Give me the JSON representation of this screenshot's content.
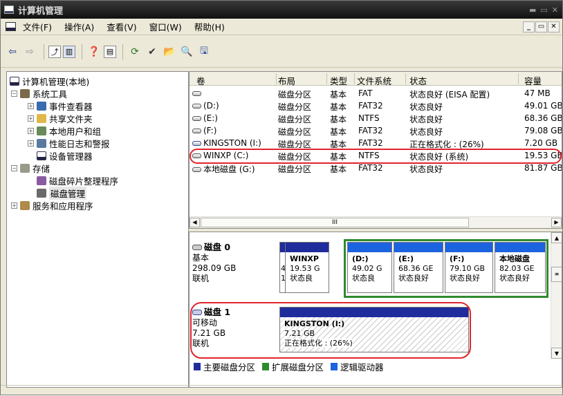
{
  "window": {
    "title": "计算机管理"
  },
  "menu": [
    "文件(F)",
    "操作(A)",
    "查看(V)",
    "窗口(W)",
    "帮助(H)"
  ],
  "tree": {
    "root": "计算机管理(本地)",
    "system_tools": "系统工具",
    "event_viewer": "事件查看器",
    "shared_folders": "共享文件夹",
    "local_users": "本地用户和组",
    "perf_logs": "性能日志和警报",
    "device_manager": "设备管理器",
    "storage": "存储",
    "defrag": "磁盘碎片整理程序",
    "disk_mgmt": "磁盘管理",
    "services": "服务和应用程序"
  },
  "volume_list": {
    "headers": [
      "卷",
      "布局",
      "类型",
      "文件系统",
      "状态",
      "容量"
    ],
    "rows": [
      {
        "vol": "",
        "layout": "磁盘分区",
        "type": "基本",
        "fs": "FAT",
        "status": "状态良好 (EISA 配置)",
        "cap": "47 MB"
      },
      {
        "vol": "(D:)",
        "layout": "磁盘分区",
        "type": "基本",
        "fs": "FAT32",
        "status": "状态良好",
        "cap": "49.01 GB"
      },
      {
        "vol": "(E:)",
        "layout": "磁盘分区",
        "type": "基本",
        "fs": "NTFS",
        "status": "状态良好",
        "cap": "68.36 GB"
      },
      {
        "vol": "(F:)",
        "layout": "磁盘分区",
        "type": "基本",
        "fs": "FAT32",
        "status": "状态良好",
        "cap": "79.08 GB"
      },
      {
        "vol": "KINGSTON (I:)",
        "layout": "磁盘分区",
        "type": "基本",
        "fs": "FAT32",
        "status": "正在格式化 : (26%)",
        "cap": "7.20 GB"
      },
      {
        "vol": "WINXP (C:)",
        "layout": "磁盘分区",
        "type": "基本",
        "fs": "NTFS",
        "status": "状态良好 (系统)",
        "cap": "19.53 GB"
      },
      {
        "vol": "本地磁盘 (G:)",
        "layout": "磁盘分区",
        "type": "基本",
        "fs": "FAT32",
        "status": "状态良好",
        "cap": "81.87 GB"
      }
    ],
    "hscroll_thumb": "III"
  },
  "disk0": {
    "name": "磁盘 0",
    "kind": "基本",
    "size": "298.09 GB",
    "state": "联机",
    "seg_tiny_a": "4",
    "seg_tiny_b": "1",
    "winxp_name": "WINXP",
    "winxp_size": "19.53 G",
    "winxp_status": "状态良",
    "d_name": "(D:)",
    "d_size": "49.02 G",
    "d_status": "状态良",
    "e_name": "(E:)",
    "e_size": "68.36 GE",
    "e_status": "状态良好",
    "f_name": "(F:)",
    "f_size": "79.10 GB",
    "f_status": "状态良好",
    "g_name": "本地磁盘",
    "g_size": "82.03 GE",
    "g_status": "状态良好"
  },
  "disk1": {
    "name": "磁盘 1",
    "kind": "可移动",
    "size": "7.21 GB",
    "state": "联机",
    "vol_name": "KINGSTON  (I:)",
    "vol_size": "7.21 GB",
    "vol_status": "正在格式化 : (26%)"
  },
  "legend": {
    "primary": "主要磁盘分区",
    "extended": "扩展磁盘分区",
    "logical": "逻辑驱动器"
  },
  "colors": {
    "primary": "#1f2c9c",
    "extended": "#2f8a2f",
    "logical": "#1c63e0",
    "highlight": "#e2232a"
  }
}
